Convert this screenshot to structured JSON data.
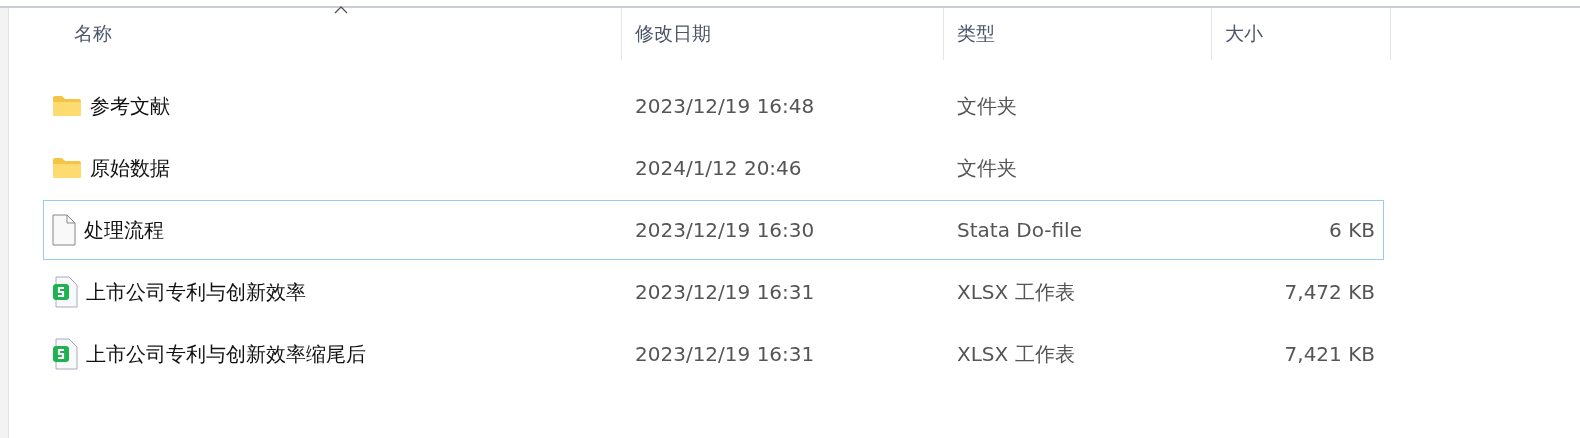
{
  "columns": [
    {
      "label": "名称",
      "sorted": true
    },
    {
      "label": "修改日期",
      "sorted": false
    },
    {
      "label": "类型",
      "sorted": false
    },
    {
      "label": "大小",
      "sorted": false
    }
  ],
  "rows": [
    {
      "kind": "folder",
      "name": "参考文献",
      "date": "2023/12/19 16:48",
      "type": "文件夹",
      "focused": false
    },
    {
      "kind": "folder",
      "name": "原始数据",
      "date": "2024/1/12 20:46",
      "type": "文件夹",
      "focused": false
    },
    {
      "kind": "document",
      "name": "处理流程",
      "date": "2023/12/19 16:30",
      "type": "Stata Do-file",
      "size": "6 KB",
      "focused": true
    },
    {
      "kind": "spreadsheet",
      "name": "上市公司专利与创新效率",
      "date": "2023/12/19 16:31",
      "type": "XLSX 工作表",
      "size": "7,472 KB",
      "focused": false
    },
    {
      "kind": "spreadsheet",
      "name": "上市公司专利与创新效率缩尾后",
      "date": "2023/12/19 16:31",
      "type": "XLSX 工作表",
      "size": "7,421 KB",
      "focused": false
    }
  ]
}
